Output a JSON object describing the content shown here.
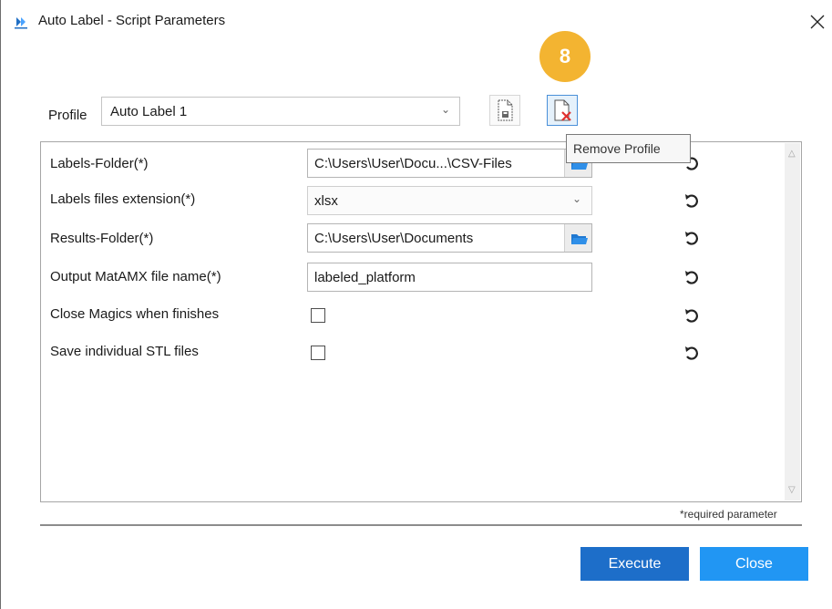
{
  "window": {
    "title": "Auto Label - Script Parameters",
    "icon": "auto-label-app-icon",
    "close_glyph": "✕"
  },
  "step_badge": "8",
  "profile": {
    "label": "Profile",
    "selected": "Auto Label 1",
    "save_icon": "save-profile-icon",
    "remove_icon": "remove-profile-icon"
  },
  "tooltip": "Remove Profile",
  "parameters": [
    {
      "label": "Labels-Folder(*)",
      "type": "folder",
      "value": "C:\\Users\\User\\Docu...\\CSV-Files"
    },
    {
      "label": "Labels files extension(*)",
      "type": "select",
      "value": "xlsx"
    },
    {
      "label": "Results-Folder(*)",
      "type": "folder",
      "value": "C:\\Users\\User\\Documents"
    },
    {
      "label": "Output MatAMX file name(*)",
      "type": "text",
      "value": "labeled_platform"
    },
    {
      "label": "Close Magics when finishes",
      "type": "checkbox",
      "checked": false
    },
    {
      "label": "Save individual STL files",
      "type": "checkbox",
      "checked": false
    }
  ],
  "required_note": "*required parameter",
  "buttons": {
    "execute": "Execute",
    "close": "Close"
  },
  "colors": {
    "badge": "#f3b431",
    "execute_button": "#1d6ec9",
    "close_button": "#2196f3",
    "folder_icon": "#1f78d1"
  }
}
